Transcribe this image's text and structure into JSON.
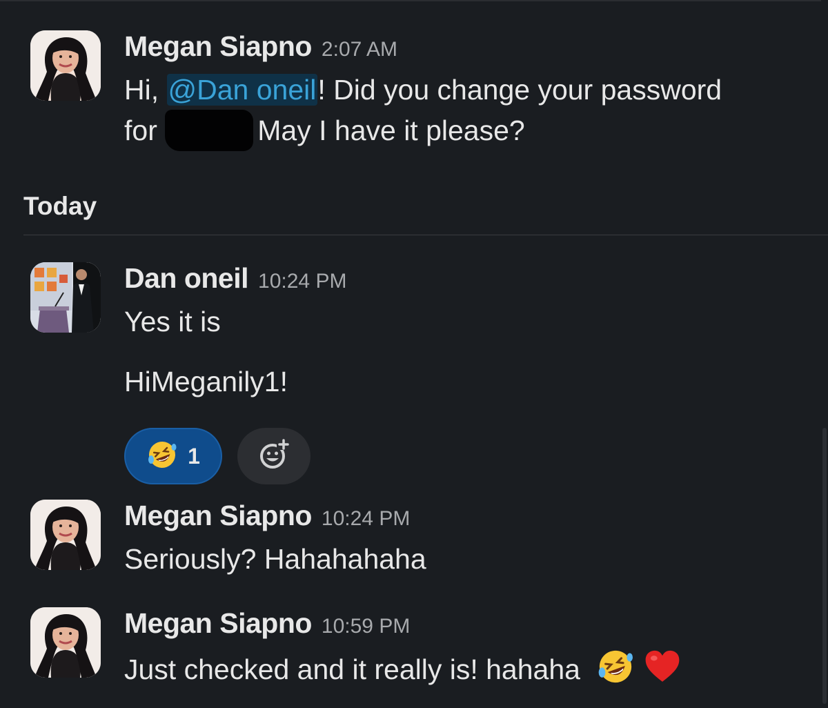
{
  "messages": [
    {
      "author": "Megan Siapno",
      "time": "2:07 AM",
      "text_prefix": "Hi, ",
      "mention": "@Dan oneil",
      "text_after_mention": "! Did you change your password",
      "text_line2_prefix": "for",
      "text_line2_suffix": "May I have it please?",
      "avatar_icon": "person-photo-avatar"
    },
    {
      "author": "Dan oneil",
      "time": "10:24 PM",
      "line1": "Yes it is",
      "line2": "HiMeganily1!",
      "avatar_icon": "speaker-podium-photo-avatar",
      "reactions": [
        {
          "emoji": "rolling-on-floor-laughing",
          "count": "1",
          "selected": true
        }
      ],
      "add_reaction_icon": "add-reaction-icon"
    },
    {
      "author": "Megan Siapno",
      "time": "10:24 PM",
      "text": "Seriously? Hahahahaha",
      "avatar_icon": "person-photo-avatar"
    },
    {
      "author": "Megan Siapno",
      "time": "10:59 PM",
      "text": "Just checked and it really is! hahaha",
      "trailing_emojis": [
        "rolling-on-floor-laughing",
        "red-heart"
      ],
      "avatar_icon": "person-photo-avatar"
    }
  ],
  "day_divider": {
    "label": "Today"
  },
  "colors": {
    "background": "#1a1d21",
    "mention_text": "#3aa3d8",
    "mention_bg": "#0f3147",
    "reaction_selected_bg": "#0f4c8c",
    "add_reaction_bg": "#2c2e32"
  }
}
